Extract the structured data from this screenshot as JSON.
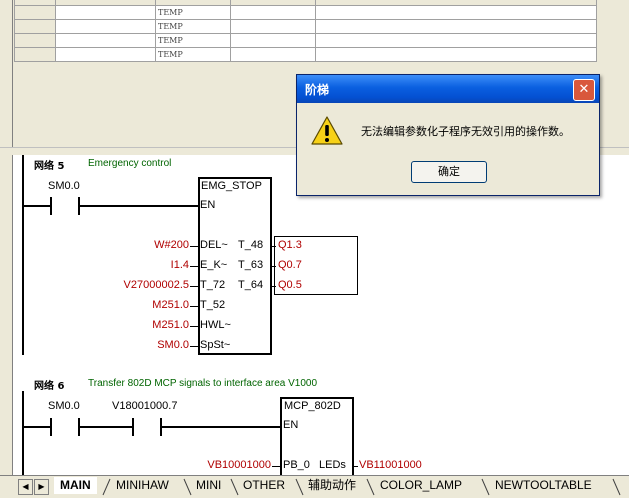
{
  "var_table": {
    "rows": [
      {
        "type": "TEMP"
      },
      {
        "type": "TEMP"
      },
      {
        "type": "TEMP"
      },
      {
        "type": "TEMP"
      }
    ]
  },
  "networks": [
    {
      "label": "网络 5",
      "comment": "Emergency control",
      "contact": "SM0.0",
      "block": {
        "name": "EMG_STOP",
        "en": "EN",
        "inputs": [
          {
            "operand": "W#200",
            "pin": "DEL~"
          },
          {
            "operand": "I1.4",
            "pin": "E_K~"
          },
          {
            "operand": "V27000002.5",
            "pin": "T_72"
          },
          {
            "operand": "M251.0",
            "pin": "T_52"
          },
          {
            "operand": "M251.0",
            "pin": "HWL~"
          },
          {
            "operand": "SM0.0",
            "pin": "SpSt~"
          }
        ],
        "outputs": [
          {
            "pin": "T_48",
            "operand": "Q1.3"
          },
          {
            "pin": "T_63",
            "operand": "Q0.7"
          },
          {
            "pin": "T_64",
            "operand": "Q0.5"
          }
        ]
      }
    },
    {
      "label": "网络 6",
      "comment": "Transfer 802D MCP signals to interface area V1000",
      "contact1": "SM0.0",
      "contact2": "V18001000.7",
      "block": {
        "name": "MCP_802D",
        "en": "EN",
        "inputs": [
          {
            "operand": "VB10001000",
            "pin": "PB_0"
          }
        ],
        "outputs": [
          {
            "pin": "LEDs",
            "operand": "VB11001000"
          }
        ]
      }
    }
  ],
  "tabs": [
    "MAIN",
    "MINIHAW",
    "MINI",
    "OTHER",
    "辅助动作",
    "COLOR_LAMP",
    "NEWTOOLTABLE"
  ],
  "tab_nav": {
    "prev": "◀",
    "next": "▶"
  },
  "dialog": {
    "title": "阶梯",
    "close": "✕",
    "message": "无法编辑参数化子程序无效引用的操作数。",
    "ok_label": "确定",
    "icon": "warning-icon"
  },
  "colors": {
    "operand_red": "#b00000",
    "comment_green": "#006400",
    "titlebar_blue": "#0a5fe0",
    "chrome": "#ece9d8"
  }
}
